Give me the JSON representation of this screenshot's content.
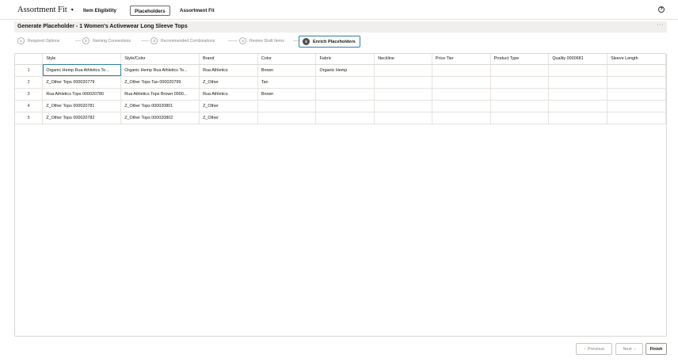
{
  "app": {
    "title": "Assortment Fit",
    "caret": "▾"
  },
  "nav": {
    "tabs": [
      {
        "label": "Item Eligibility"
      },
      {
        "label": "Placeholders"
      },
      {
        "label": "Assortment Fit"
      }
    ],
    "help_glyph": "?"
  },
  "page": {
    "title": "Generate Placeholder - 1 Women's Activewear Long Sleeve Tops",
    "more_glyph": "···"
  },
  "train": {
    "steps": [
      {
        "num": "1",
        "label": "Required Options"
      },
      {
        "num": "2",
        "label": "Naming Conventions"
      },
      {
        "num": "3",
        "label": "Recommended Combinations"
      },
      {
        "num": "4",
        "label": "Review Draft Items"
      },
      {
        "num": "5",
        "label": "Enrich Placeholders"
      }
    ]
  },
  "grid": {
    "columns": [
      "",
      "Style",
      "Style/Color",
      "Brand",
      "Color",
      "Fabric",
      "Neckline",
      "Price Tier",
      "Product Type",
      "Quality 0000681",
      "Sleeve Length"
    ],
    "rows": [
      {
        "num": "1",
        "cells": [
          "Organic Hemp Rua Athletics To...",
          "Organic Hemp Rua Athletics To...",
          "Rua Athletics",
          "Brown",
          "Organic Hemp",
          "",
          "",
          "",
          "",
          ""
        ]
      },
      {
        "num": "2",
        "cells": [
          "Z_Other Tops 000020779",
          "Z_Other Tops Tan 000020799",
          "Z_Other",
          "Tan",
          "",
          "",
          "",
          "",
          "",
          ""
        ]
      },
      {
        "num": "3",
        "cells": [
          "Rua Athletics Tops 000020780",
          "Rua Athletics Tops Brown 0000...",
          "Rua Athletics",
          "Brown",
          "",
          "",
          "",
          "",
          "",
          ""
        ]
      },
      {
        "num": "4",
        "cells": [
          "Z_Other Tops 000020781",
          "Z_Other Tops 000020801",
          "Z_Other",
          "",
          "",
          "",
          "",
          "",
          "",
          ""
        ]
      },
      {
        "num": "5",
        "cells": [
          "Z_Other Tops 000020782",
          "Z_Other Tops 000020802",
          "Z_Other",
          "",
          "",
          "",
          "",
          "",
          "",
          ""
        ]
      }
    ]
  },
  "footer": {
    "previous_label": "Previous",
    "previous_glyph": "‹",
    "next_label": "Next",
    "next_glyph": "›",
    "finish_label": "Finish"
  }
}
